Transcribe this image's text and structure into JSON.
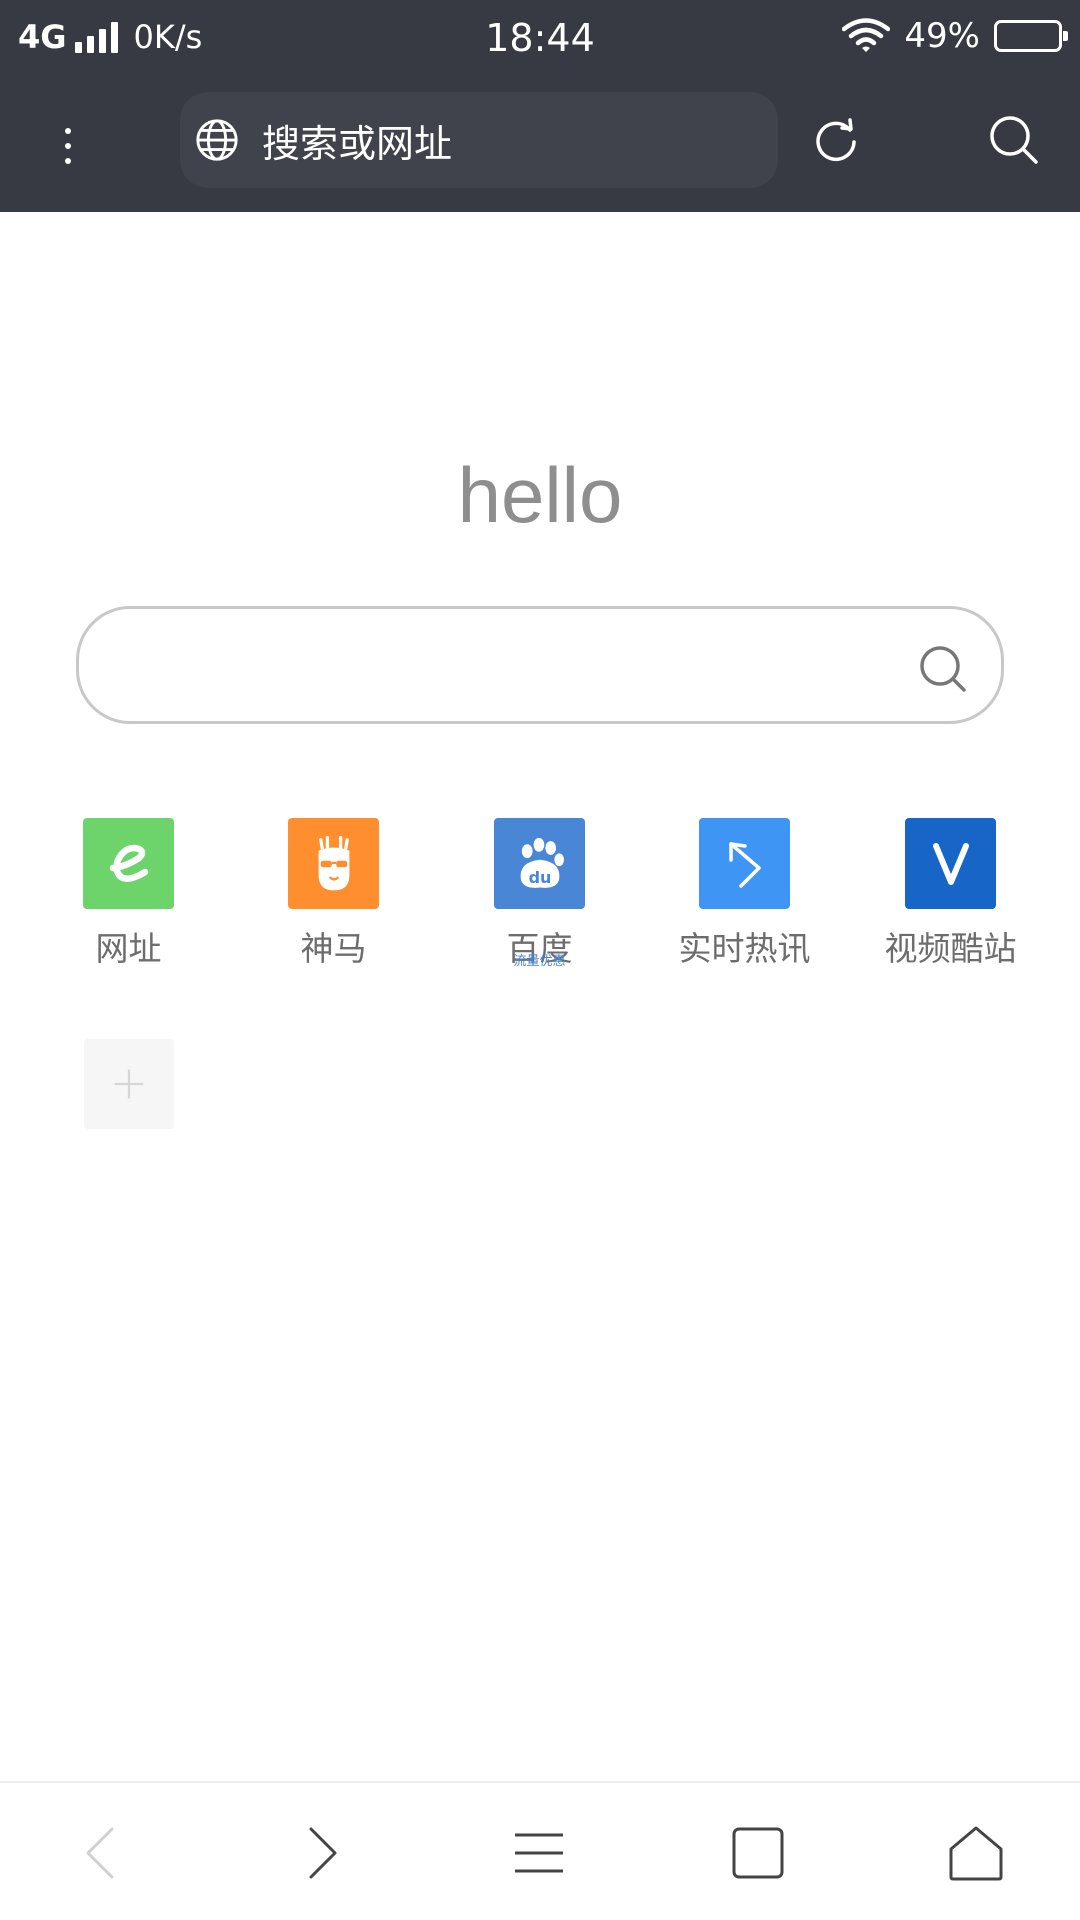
{
  "status_bar": {
    "network": "4G",
    "speed": "0K/s",
    "time": "18:44",
    "battery_percent": "49%",
    "battery_level": 0.49
  },
  "address_bar": {
    "placeholder": "搜索或网址",
    "icons": [
      "more-vertical-icon",
      "globe-icon",
      "refresh-icon",
      "search-icon"
    ]
  },
  "homepage": {
    "greeting": "hello",
    "search_placeholder": ""
  },
  "shortcuts": [
    {
      "label": "网址",
      "icon": "e-letter-icon",
      "color": "#6cd46a"
    },
    {
      "label": "神马",
      "icon": "alpaca-icon",
      "color": "#ff8e2e"
    },
    {
      "label": "百度",
      "icon": "baidu-paw-icon",
      "color": "#4a86d6",
      "sub": "流量优惠"
    },
    {
      "label": "实时热讯",
      "icon": "arrow-icon",
      "color": "#3f95f3"
    },
    {
      "label": "视频酷站",
      "icon": "v-letter-icon",
      "color": "#1766c7"
    }
  ],
  "add_tile": {
    "icon": "plus-icon"
  },
  "bottom_nav": {
    "icons": [
      "back-icon",
      "forward-icon",
      "menu-icon",
      "tabs-icon",
      "home-icon"
    ]
  },
  "colors": {
    "topbar_bg": "#373a42",
    "greeting": "#8e8e8e",
    "label": "#6d6d6d"
  }
}
